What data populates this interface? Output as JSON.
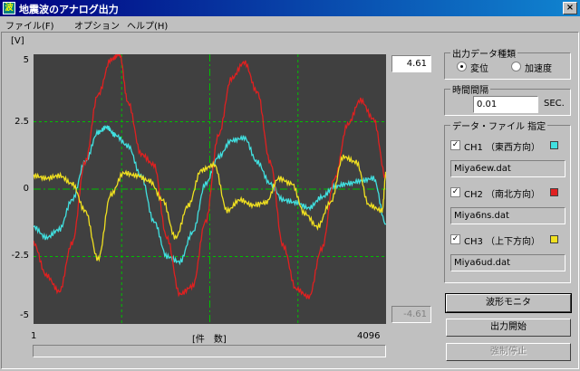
{
  "window": {
    "title": "地震波のアナログ出力",
    "close_glyph": "×",
    "icon": "波"
  },
  "menu": [
    {
      "label": "ファイル(F)"
    },
    {
      "label": "オプション"
    },
    {
      "label": "ヘルプ(H)"
    }
  ],
  "chart": {
    "y_unit": "[V]",
    "y_ticks": [
      "5",
      "2.5",
      "0",
      "-2.5",
      "-5"
    ],
    "max_value": "4.61",
    "min_value": "-4.61",
    "x_start": "1",
    "x_end": "4096",
    "x_label": "[件　数]",
    "progress": 0
  },
  "output_type": {
    "title": "出力データ種類",
    "option_displacement": "変位",
    "option_acceleration": "加速度",
    "selected": "変位"
  },
  "interval": {
    "title": "時間間隔",
    "value": "0.01",
    "unit": "SEC."
  },
  "files": {
    "title": "データ・ファイル 指定",
    "channels": [
      {
        "label": "CH1 （東西方向）",
        "file": "Miya6ew.dat",
        "color": "#40e0e0",
        "checked": true
      },
      {
        "label": "CH2 （南北方向）",
        "file": "Miya6ns.dat",
        "color": "#e02020",
        "checked": true
      },
      {
        "label": "CH3 （上下方向）",
        "file": "Miya6ud.dat",
        "color": "#f0e020",
        "checked": true
      }
    ]
  },
  "buttons": {
    "monitor": "波形モニタ",
    "start": "出力開始",
    "stop": "強制停止"
  },
  "chart_data": {
    "type": "line",
    "ylim": [
      -5,
      5
    ],
    "xlim": [
      1,
      4096
    ],
    "y_unit": "[V]",
    "xlabel": "[件　数]",
    "series": [
      {
        "color": "#40e0e0",
        "x": [
          1,
          150,
          300,
          450,
          600,
          750,
          850,
          950,
          1100,
          1250,
          1400,
          1550,
          1700,
          1850,
          2000,
          2150,
          2300,
          2450,
          2600,
          2750,
          2900,
          3050,
          3200,
          3350,
          3500,
          3650,
          3800,
          3950,
          4096
        ],
        "y": [
          -1.4,
          -1.8,
          -1.5,
          -0.4,
          1.0,
          2.1,
          2.3,
          2.0,
          1.6,
          0.5,
          -1.2,
          -2.5,
          -2.7,
          -1.6,
          0.2,
          1.2,
          1.8,
          1.9,
          1.0,
          0.2,
          -0.4,
          -0.5,
          -0.7,
          -0.3,
          0.1,
          0.2,
          0.3,
          0.4,
          -1.3
        ]
      },
      {
        "color": "#e02020",
        "x": [
          1,
          150,
          300,
          450,
          600,
          750,
          900,
          1000,
          1100,
          1250,
          1400,
          1550,
          1700,
          1850,
          2000,
          2150,
          2300,
          2450,
          2600,
          2750,
          2900,
          3050,
          3200,
          3350,
          3500,
          3650,
          3800,
          3950,
          4096
        ],
        "y": [
          -2.0,
          -3.2,
          -3.8,
          -2.0,
          1.0,
          3.5,
          4.8,
          5.0,
          3.2,
          1.3,
          0.9,
          -1.8,
          -3.9,
          -3.6,
          -1.2,
          2.0,
          4.1,
          4.7,
          3.6,
          1.0,
          -2.1,
          -3.7,
          -4.0,
          -2.2,
          0.4,
          2.4,
          3.3,
          2.6,
          0.4
        ]
      },
      {
        "color": "#f0e020",
        "x": [
          1,
          150,
          300,
          450,
          600,
          750,
          900,
          1050,
          1200,
          1350,
          1500,
          1650,
          1800,
          1950,
          2100,
          2250,
          2400,
          2550,
          2700,
          2850,
          3000,
          3150,
          3300,
          3450,
          3600,
          3750,
          3900,
          4050,
          4096
        ],
        "y": [
          0.5,
          0.4,
          0.5,
          0.2,
          -0.8,
          -2.6,
          -0.2,
          0.6,
          0.5,
          0.3,
          -0.4,
          -1.8,
          -0.6,
          0.7,
          0.9,
          -0.8,
          -0.4,
          -0.6,
          -0.5,
          0.4,
          0.2,
          -0.9,
          -1.4,
          -0.5,
          1.2,
          1.0,
          -0.6,
          -0.8,
          0.6
        ]
      }
    ]
  }
}
